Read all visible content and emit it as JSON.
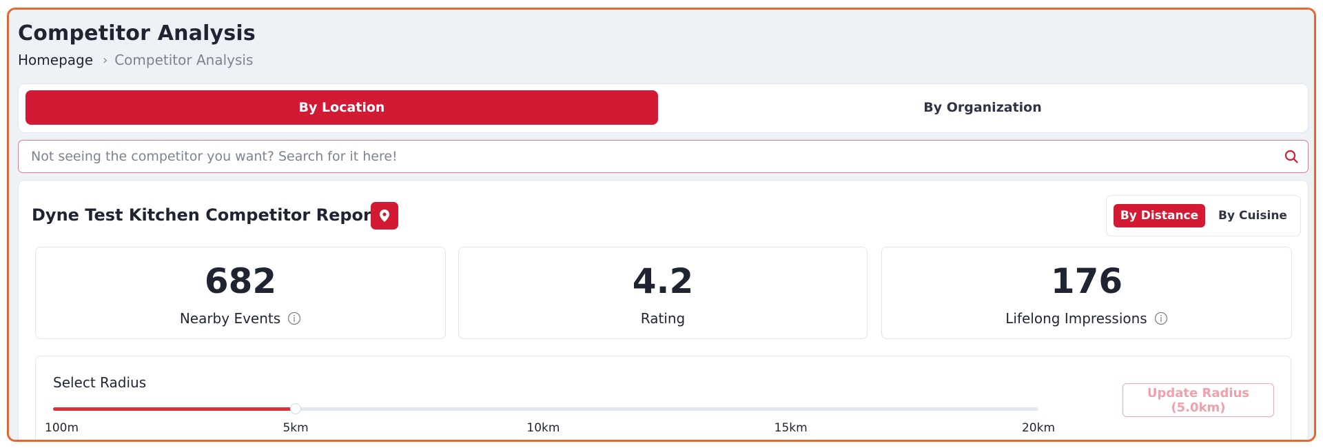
{
  "header": {
    "title": "Competitor Analysis",
    "breadcrumb": {
      "home": "Homepage",
      "separator": "›",
      "current": "Competitor Analysis"
    }
  },
  "tabs": [
    {
      "label": "By Location",
      "active": true
    },
    {
      "label": "By Organization",
      "active": false
    }
  ],
  "search": {
    "value": "",
    "placeholder": "Not seeing the competitor you want? Search for it here!",
    "icon": "search-icon"
  },
  "report": {
    "title": "Dyne Test Kitchen Competitor Report",
    "pin_icon": "map-pin-icon",
    "view_toggle": [
      {
        "label": "By Distance",
        "active": true
      },
      {
        "label": "By Cuisine",
        "active": false
      }
    ],
    "stats": [
      {
        "value": "682",
        "label": "Nearby Events",
        "info_icon": true
      },
      {
        "value": "4.2",
        "label": "Rating",
        "info_icon": false
      },
      {
        "value": "176",
        "label": "Lifelong Impressions",
        "info_icon": true
      }
    ],
    "radius": {
      "label": "Select Radius",
      "min_km": 0.1,
      "max_km": 20,
      "selected_km": 5,
      "ticks": [
        {
          "label": "100m",
          "km": 0.1
        },
        {
          "label": "5km",
          "km": 5
        },
        {
          "label": "10km",
          "km": 10
        },
        {
          "label": "15km",
          "km": 15
        },
        {
          "label": "20km",
          "km": 20
        }
      ],
      "update_button_line1": "Update Radius",
      "update_button_line2": "(5.0km)"
    }
  },
  "colors": {
    "accent": "#d31a34",
    "frame_border": "#e8672e",
    "slider_fill": "#d8323a",
    "disabled_text": "#efa0ab"
  }
}
